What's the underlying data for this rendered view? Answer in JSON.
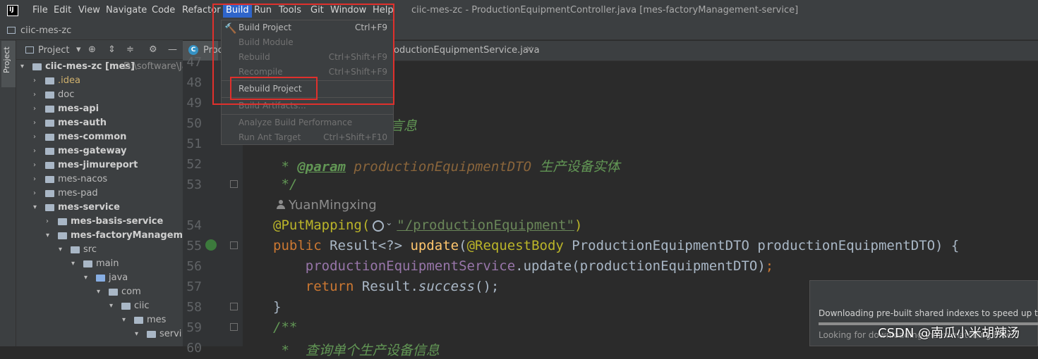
{
  "titlebar": {
    "menus": [
      "File",
      "Edit",
      "View",
      "Navigate",
      "Code",
      "Refactor",
      "Build",
      "Run",
      "Tools",
      "Git",
      "Window",
      "Help"
    ],
    "active_menu": "Build",
    "window_title": "ciic-mes-zc - ProductionEquipmentController.java [mes-factoryManagement-service]"
  },
  "navbar": {
    "root": "ciic-mes-zc"
  },
  "tool_strip": {
    "project_label": "Project"
  },
  "project_panel": {
    "title": "Project",
    "tree": [
      {
        "label": "ciic-mes-zc [mes]",
        "extra": "D:\\software\\Ja",
        "bold": true,
        "arrow": "open",
        "indent": 0
      },
      {
        "label": ".idea",
        "arrow": "closed",
        "indent": 1,
        "style": "idea"
      },
      {
        "label": "doc",
        "arrow": "closed",
        "indent": 1
      },
      {
        "label": "mes-api",
        "arrow": "closed",
        "indent": 1,
        "bold": true
      },
      {
        "label": "mes-auth",
        "arrow": "closed",
        "indent": 1,
        "bold": true
      },
      {
        "label": "mes-common",
        "arrow": "closed",
        "indent": 1,
        "bold": true
      },
      {
        "label": "mes-gateway",
        "arrow": "closed",
        "indent": 1,
        "bold": true
      },
      {
        "label": "mes-jimureport",
        "arrow": "closed",
        "indent": 1,
        "bold": true
      },
      {
        "label": "mes-nacos",
        "arrow": "closed",
        "indent": 1
      },
      {
        "label": "mes-pad",
        "arrow": "closed",
        "indent": 1
      },
      {
        "label": "mes-service",
        "arrow": "open",
        "indent": 1,
        "bold": true
      },
      {
        "label": "mes-basis-service",
        "arrow": "closed",
        "indent": 2,
        "bold": true
      },
      {
        "label": "mes-factoryManagement-",
        "arrow": "open",
        "indent": 2,
        "bold": true
      },
      {
        "label": "src",
        "arrow": "open",
        "indent": 3
      },
      {
        "label": "main",
        "arrow": "open",
        "indent": 4
      },
      {
        "label": "java",
        "arrow": "open",
        "indent": 5,
        "blue": true
      },
      {
        "label": "com",
        "arrow": "open",
        "indent": 6
      },
      {
        "label": "ciic",
        "arrow": "open",
        "indent": 7
      },
      {
        "label": "mes",
        "arrow": "open",
        "indent": 8
      },
      {
        "label": "servi",
        "arrow": "open",
        "indent": 9
      }
    ]
  },
  "editor": {
    "tab1_icon": "C",
    "tab1_label": "Proc",
    "tab2_label": "roductionEquipmentService.java",
    "tab2_close": "×",
    "line_numbers": [
      "47",
      "48",
      "49",
      "50",
      "51",
      "52",
      "53",
      "54",
      "55",
      "56",
      "57",
      "58",
      "59",
      "60"
    ],
    "doc_fragment": "言息",
    "doc_param_star": " * ",
    "doc_param_tag": "@param",
    "doc_param_name": " productionEquipmentDTO",
    "doc_param_desc": " 生产设备实体",
    "doc_end": " */",
    "author": "YuanMingxing",
    "mapping_annotation": "@PutMapping(",
    "mapping_path": "\"/productionEquipment\"",
    "mapping_close": ")",
    "sig_public": "public ",
    "sig_result": "Result<?> ",
    "sig_update": "update",
    "sig_open": "(",
    "sig_reqbody": "@RequestBody",
    "sig_params": " ProductionEquipmentDTO productionEquipmentDTO) {",
    "body_field": "    productionEquipmentService",
    "body_call": ".update(productionEquipmentDTO)",
    "body_semicolon": ";",
    "ret_kw": "    return ",
    "ret_result": "Result.",
    "ret_success": "success",
    "ret_end": "();",
    "close_brace": "}",
    "next_doc_open": "/**",
    "next_doc_text": " *  查询单个生产设备信息"
  },
  "build_menu": {
    "items": [
      {
        "label": "Build Project",
        "shortcut": "Ctrl+F9",
        "enabled": true
      },
      {
        "label": "Build Module",
        "shortcut": "",
        "enabled": false
      },
      {
        "label": "Rebuild",
        "shortcut": "Ctrl+Shift+F9",
        "enabled": false
      },
      {
        "label": "Recompile",
        "shortcut": "Ctrl+Shift+F9",
        "enabled": false
      },
      {
        "label": "Rebuild Project",
        "shortcut": "",
        "enabled": true
      },
      {
        "label": "Build Artifacts...",
        "shortcut": "",
        "enabled": false
      },
      {
        "label": "Analyze Build Performance",
        "shortcut": "",
        "enabled": false
      },
      {
        "label": "Run Ant Target",
        "shortcut": "Ctrl+Shift+F10",
        "enabled": false
      }
    ]
  },
  "notification": {
    "text": "Downloading pre-built shared indexes to speed up th",
    "sub": "Looking for downloading index matching index"
  },
  "watermark": "CSDN @南瓜小米胡辣汤",
  "colors": {
    "accent": "#2f65ca",
    "annotation_red": "#e0302c",
    "background": "#2b2b2b"
  }
}
